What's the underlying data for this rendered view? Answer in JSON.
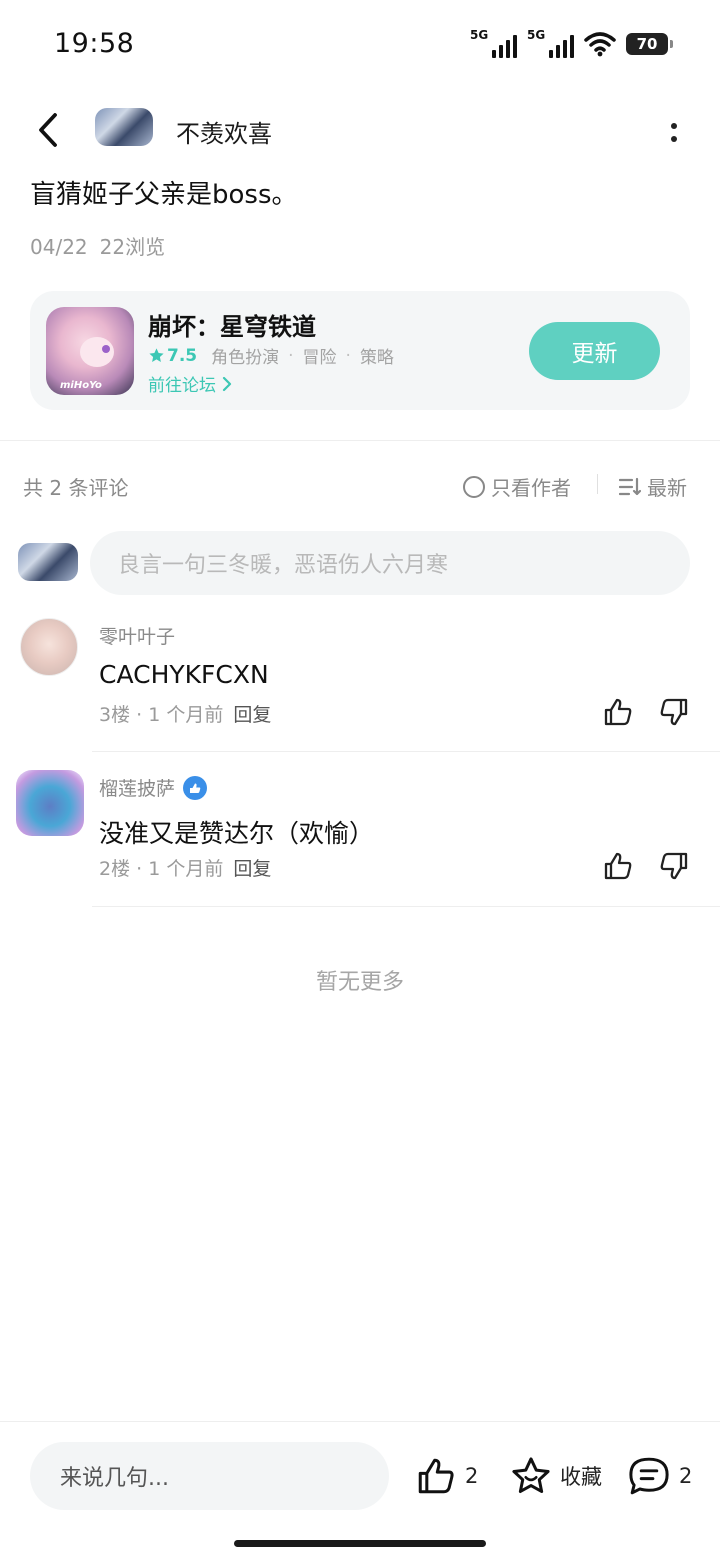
{
  "status_bar": {
    "time": "19:58",
    "network1": "5G",
    "network2": "5G",
    "battery": "70"
  },
  "header": {
    "author_name": "不羡欢喜"
  },
  "post": {
    "title": "盲猜姬子父亲是boss。",
    "date": "04/22",
    "views": "22浏览"
  },
  "game_card": {
    "name": "崩坏：星穹铁道",
    "rating": "7.5",
    "tags": [
      "角色扮演",
      "冒险",
      "策略"
    ],
    "forum_link": "前往论坛",
    "update_label": "更新",
    "icon_logo": "miHoYo"
  },
  "comments_header": {
    "count": "共 2 条评论",
    "author_only": "只看作者",
    "sort": "最新"
  },
  "comment_input": {
    "placeholder": "良言一句三冬暖，恶语伤人六月寒"
  },
  "comments": [
    {
      "user": "零叶叶子",
      "text": "CACHYKFCXN",
      "floor": "3楼",
      "time": "1 个月前",
      "reply": "回复",
      "verified": false
    },
    {
      "user": "榴莲披萨",
      "text": "没准又是赞达尔（欢愉）",
      "floor": "2楼",
      "time": "1 个月前",
      "reply": "回复",
      "verified": true
    }
  ],
  "no_more": "暂无更多",
  "bottom_bar": {
    "input_placeholder": "来说几句...",
    "like_count": "2",
    "favorite_label": "收藏",
    "comment_count": "2"
  },
  "colors": {
    "accent": "#5fd0c1",
    "accent_text": "#3cc7b4",
    "verified": "#3a8fe8"
  }
}
